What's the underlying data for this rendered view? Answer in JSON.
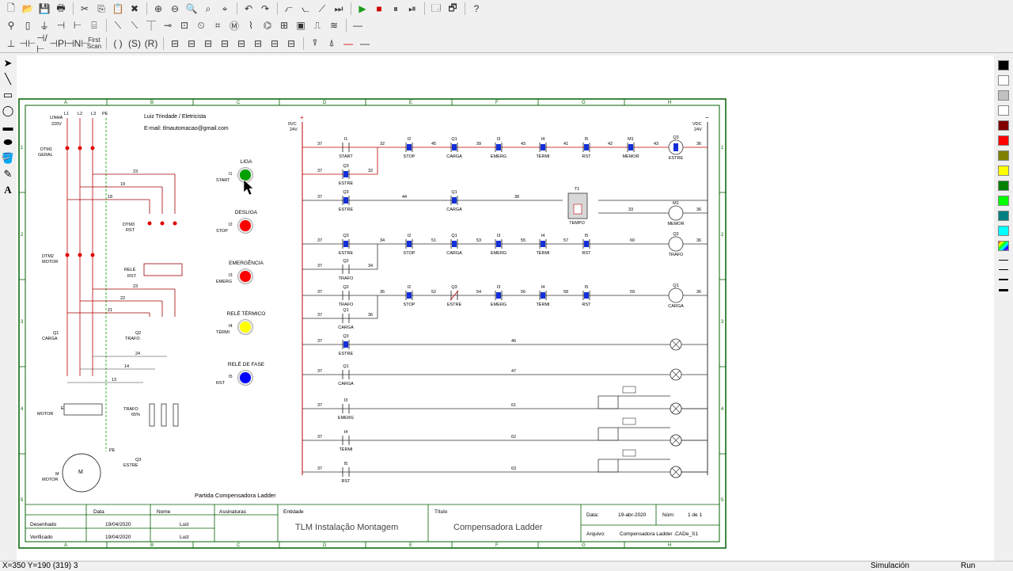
{
  "toolbar": {
    "first_scan_label": "First Scan"
  },
  "frame": {
    "columns": [
      "A",
      "B",
      "C",
      "D",
      "E",
      "F",
      "G",
      "H"
    ],
    "rows": [
      "1",
      "2",
      "3",
      "4",
      "5"
    ]
  },
  "power": {
    "author": "Luiz Trindade / Eletricista",
    "email": "E-mail: tlmautomacao@gmail.com",
    "linha": "LINHA",
    "linha_v": "220V",
    "phases": [
      "L1",
      "L2",
      "L3",
      "PE"
    ],
    "dtm1": "DTM1",
    "dtm1_sub": "GERAL",
    "dtm3": "DTM3",
    "dtm3_sub": "RST",
    "dtm2": "DTM2",
    "dtm2_sub": "MOTOR",
    "rele": "RELÉ",
    "rele_sub": "RST",
    "q1": "Q1",
    "q1_sub": "CARGA",
    "q2": "Q2",
    "q2_sub": "TRAFO",
    "q3": "Q3",
    "q3_sub": "ESTRE",
    "trafo": "TRAFO",
    "trafo_pct": "65%",
    "motor_e": "E",
    "motor_e_sub": "MOTOR",
    "motor_m": "M",
    "motor_m_sub": "MOTOR",
    "wires": [
      "23",
      "19",
      "18",
      "23",
      "22",
      "21",
      "14",
      "13",
      "24"
    ],
    "caption": "Partida Compensadora Ladder"
  },
  "panel": {
    "buttons": [
      {
        "title": "LIGA",
        "tag": "I1",
        "sub": "START",
        "color": "#00a000"
      },
      {
        "title": "DESLIGA",
        "tag": "I2",
        "sub": "STOP",
        "color": "#ff0000"
      },
      {
        "title": "EMERGÊNCIA",
        "tag": "I3",
        "sub": "EMERG",
        "color": "#ff0000"
      },
      {
        "title": "RELÉ TÉRMICO",
        "tag": "I4",
        "sub": "TÉRMI",
        "color": "#ffff00"
      },
      {
        "title": "RELÉ DE FASE",
        "tag": "I5",
        "sub": "RST",
        "color": "#0000ff"
      }
    ]
  },
  "ladder": {
    "left_rail_top": "0VC",
    "left_rail_v": "24V",
    "right_rail_top": "VDC",
    "right_rail_v": "24V",
    "rung1": [
      "I1",
      "START",
      "I2",
      "STOP",
      "Q1",
      "CARGA",
      "I3",
      "EMERG",
      "I4",
      "TÉRMI",
      "I5",
      "RST",
      "M1",
      "MEMOR",
      "Q3",
      "ESTRE"
    ],
    "rung1b": [
      "Q3",
      "ESTRE"
    ],
    "rung2": [
      "Q3",
      "ESTRE",
      "Q1",
      "CARGA",
      "T1",
      "TEMPO",
      "M1",
      "MEMOR"
    ],
    "rung3": [
      "Q3",
      "ESTRE",
      "I2",
      "STOP",
      "Q1",
      "CARGA",
      "I3",
      "EMERG",
      "I4",
      "TÉRMI",
      "I5",
      "RST",
      "Q2",
      "TRAFO"
    ],
    "rung3b": [
      "Q2",
      "TRAFO"
    ],
    "rung4": [
      "Q2",
      "TRAFO",
      "I2",
      "STOP",
      "Q3",
      "ESTRE",
      "I3",
      "EMERG",
      "I4",
      "TÉRMI",
      "I5",
      "RST",
      "Q1",
      "CARGA"
    ],
    "rung4b": [
      "Q1",
      "CARGA"
    ],
    "rung5": [
      "Q3",
      "ESTRE"
    ],
    "rung6": [
      "Q1",
      "CARGA"
    ],
    "rung7": [
      "I3",
      "EMERG"
    ],
    "rung8": [
      "I4",
      "TÉRMI"
    ],
    "rung9": [
      "I5",
      "RST"
    ],
    "nodes": [
      "37",
      "32",
      "45",
      "39",
      "43",
      "41",
      "42",
      "43",
      "36",
      "34",
      "44",
      "38",
      "33",
      "36",
      "34",
      "51",
      "53",
      "55",
      "57",
      "60",
      "36",
      "52",
      "54",
      "56",
      "58",
      "59",
      "46",
      "47",
      "61",
      "62",
      "63"
    ],
    "lamps": [
      "Q1",
      "Q2",
      "Q3",
      "I3",
      "I4",
      "I5"
    ],
    "lamp_labels": [
      "ESTRE",
      "CARGA",
      "EMERG",
      "TÉRMI",
      "RST"
    ]
  },
  "title_block": {
    "data_label": "Data",
    "nome_label": "Nome",
    "assinaturas_label": "Assinaturas",
    "entidade_label": "Entidade",
    "titulo_label": "Título",
    "desenhado_label": "Desenhado",
    "verificado_label": "Verificado",
    "desenhado_date": "19/04/2020",
    "verificado_date": "19/04/2020",
    "desenhado_name": "Luiz",
    "verificado_name": "Luiz",
    "entidade": "TLM Instalação Montagem",
    "titulo": "Compensadora Ladder",
    "data_label2": "Data:",
    "date_value": "19-abr-2020",
    "num_label": "Núm:",
    "num_value": "1 de 1",
    "arquivo_label": "Arquivo:",
    "arquivo_value": "Compensadora Ladder .CADe_S1"
  },
  "status": {
    "coords": "X=350  Y=190 (319) 3",
    "mode": "Simulación",
    "run": "Run"
  },
  "palette": [
    "#000000",
    "#ffffff",
    "#c0c0c0",
    "#ffffff",
    "#800000",
    "#ff0000",
    "#808000",
    "#ffff00",
    "#008000",
    "#00ff00",
    "#008080",
    "#00ffff"
  ]
}
